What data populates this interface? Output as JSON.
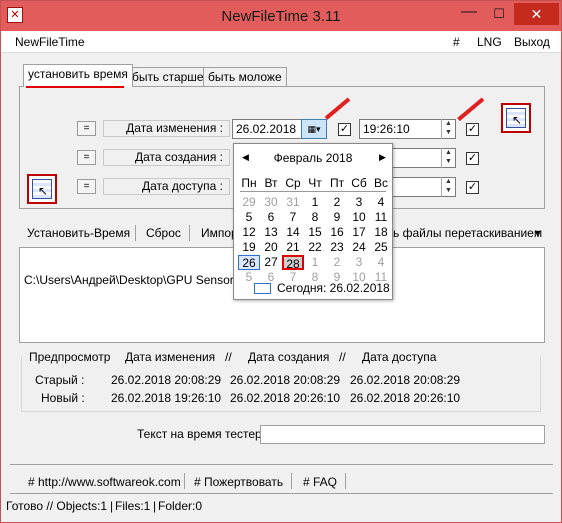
{
  "window": {
    "title": "NewFileTime 3.11",
    "controls": {
      "minimize": "—",
      "maximize": "☐",
      "close": "✕"
    }
  },
  "menu": {
    "app": "NewFileTime",
    "hash": "#",
    "lng": "LNG",
    "exit": "Выход"
  },
  "tabs": [
    "установить время",
    "быть старше",
    "быть моложе"
  ],
  "colors": {
    "titlebar": "#e25c5c",
    "close": "#c42b1c",
    "highlight": "#e00000",
    "selection": "#2b6fd6"
  },
  "rows": [
    {
      "eq": "=",
      "label": "Дата изменения :",
      "date": "26.02.2018",
      "time": "19:26:10"
    },
    {
      "eq": "=",
      "label": "Дата создания :",
      "date": "",
      "time": "10"
    },
    {
      "eq": "=",
      "label": "Дата доступа :",
      "date": "",
      "time": "10"
    }
  ],
  "checkmark": "✓",
  "calendar": {
    "month": "Февраль 2018",
    "weekdays": [
      "Пн",
      "Вт",
      "Ср",
      "Чт",
      "Пт",
      "Сб",
      "Вс"
    ],
    "weeks": [
      [
        "29",
        "30",
        "31",
        "1",
        "2",
        "3",
        "4"
      ],
      [
        "5",
        "6",
        "7",
        "8",
        "9",
        "10",
        "11"
      ],
      [
        "12",
        "13",
        "14",
        "15",
        "16",
        "17",
        "18"
      ],
      [
        "19",
        "20",
        "21",
        "22",
        "23",
        "24",
        "25"
      ],
      [
        "26",
        "27",
        "28",
        "1",
        "2",
        "3",
        "4"
      ],
      [
        "5",
        "6",
        "7",
        "8",
        "9",
        "10",
        "11"
      ]
    ],
    "today": "Сегодня: 26.02.2018"
  },
  "toolbar2": {
    "set_time": "Установить-Время",
    "reset": "Сброс",
    "import": "Импор",
    "drag_files": "ь файлы перетаскиванием",
    "dropdown": "▼"
  },
  "file": "C:\\Users\\Андрей\\Desktop\\GPU Sensor.txt",
  "preview": {
    "preview_label": "Предпросмотр",
    "col_modified": "Дата изменения",
    "col_created": "Дата создания",
    "col_access": "Дата доступа",
    "sep": "//",
    "old_label": "Старый :",
    "new_label": "Новый :",
    "old": [
      "26.02.2018 20:08:29",
      "26.02.2018 20:08:29",
      "26.02.2018 20:08:29"
    ],
    "new": [
      "26.02.2018 19:26:10",
      "26.02.2018 20:26:10",
      "26.02.2018 20:26:10"
    ]
  },
  "tester_label": "Текст на время тестер",
  "links": [
    "# http://www.softwareok.com",
    "# Пожертвовать",
    "# FAQ"
  ],
  "status": [
    "Готово // Objects:1",
    "Files:1",
    "Folder:0"
  ]
}
